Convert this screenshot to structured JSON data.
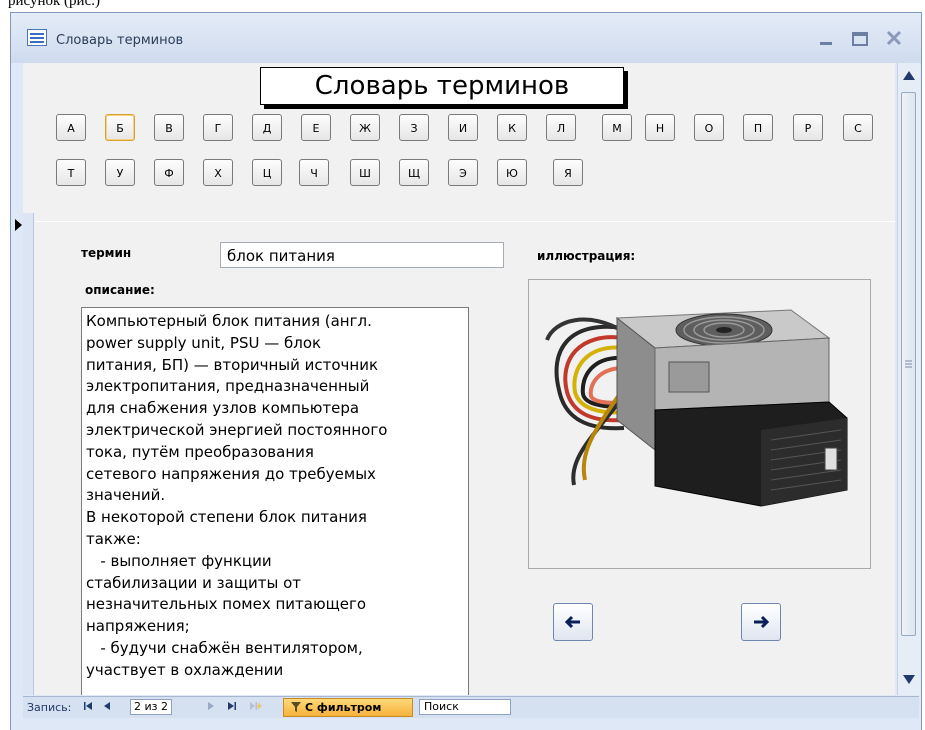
{
  "caption": "рисунок (рис.)",
  "window": {
    "title": "Словарь терминов",
    "icon": "form-icon",
    "controls": [
      "minimize-icon",
      "maximize-icon",
      "close-icon"
    ]
  },
  "form": {
    "header": "Словарь терминов",
    "letters_row1": [
      "А",
      "Б",
      "В",
      "Г",
      "Д",
      "Е",
      "Ж",
      "З",
      "И",
      "К",
      "Л",
      "М",
      "Н",
      "О",
      "П",
      "Р",
      "С"
    ],
    "letters_row2": [
      "Т",
      "У",
      "Ф",
      "Х",
      "Ц",
      "Ч",
      "Ш",
      "Щ",
      "Э",
      "Ю",
      "Я"
    ],
    "selected_letter": "Б",
    "term_label": "термин",
    "term_value": "блок питания",
    "illustration_label": "иллюстрация:",
    "description_label": "описание:",
    "description": "Компьютерный блок питания (англ.\npower supply unit, PSU — блок\nпитания, БП) — вторичный источник\nэлектропитания, предназначенный\nдля снабжения узлов компьютера\nэлектрической энергией постоянного\nтока, путём преобразования\nсетевого напряжения до требуемых\nзначений.\nВ некоторой степени блок питания\nтакже:\n   - выполняет функции\nстабилизации и защиты от\nнезначительных помех питающего\nнапряжения;\n   - будучи снабжён вентилятором,\nучаствует в охлаждении",
    "nav_prev_icon": "arrow-left-icon",
    "nav_next_icon": "arrow-right-icon"
  },
  "statusbar": {
    "record_label": "Запись:",
    "current_record": "2 из 2",
    "filter_label": "С фильтром",
    "search_label": "Поиск"
  },
  "colors": {
    "window_bg": "#dfe8f6",
    "form_bg": "#f1f1f1",
    "filter_accent": "#f5b23a",
    "selected_letter_border": "#d9a233"
  }
}
